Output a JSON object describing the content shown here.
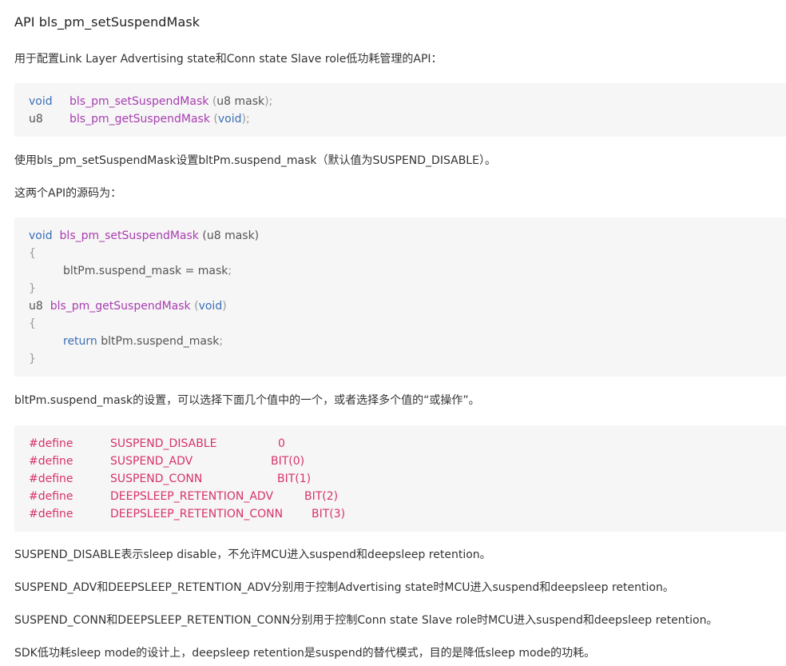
{
  "heading": "API bls_pm_setSuspendMask",
  "intro": "用于配置Link Layer Advertising state和Conn state Slave role低功耗管理的API：",
  "code1": {
    "line1": {
      "type": "void",
      "name": "bls_pm_setSuspendMask",
      "open": "(",
      "arg": "u8 mask",
      "close": ");"
    },
    "line2": {
      "type": "u8",
      "name": "bls_pm_getSuspendMask",
      "open": "(",
      "arg": "void",
      "close": ");"
    }
  },
  "para2": "使用bls_pm_setSuspendMask设置bltPm.suspend_mask（默认值为SUSPEND_DISABLE）。",
  "para3": "这两个API的源码为：",
  "code2": {
    "l1_type": "void",
    "l1_name": "bls_pm_setSuspendMask",
    "l1_args": "(u8 mask)",
    "brace_open": "{",
    "l3_body": "bltPm.suspend_mask = mask",
    "semicolon": ";",
    "brace_close": "}",
    "l5_type": "u8",
    "l5_name": "bls_pm_getSuspendMask",
    "l5_open": "(",
    "l5_arg": "void",
    "l5_close": ")",
    "l7_kw": "return",
    "l7_body": "bltPm.suspend_mask"
  },
  "para4": "bltPm.suspend_mask的设置，可以选择下面几个值中的一个，或者选择多个值的“或操作”。",
  "defines": [
    {
      "kw": "#define",
      "name": "SUSPEND_DISABLE",
      "value": "0"
    },
    {
      "kw": "#define",
      "name": "SUSPEND_ADV",
      "value": "BIT(0)"
    },
    {
      "kw": "#define",
      "name": "SUSPEND_CONN",
      "value": "BIT(1)"
    },
    {
      "kw": "#define",
      "name": "DEEPSLEEP_RETENTION_ADV",
      "value": "BIT(2)"
    },
    {
      "kw": "#define",
      "name": "DEEPSLEEP_RETENTION_CONN",
      "value": "BIT(3)"
    }
  ],
  "para5": "SUSPEND_DISABLE表示sleep disable，不允许MCU进入suspend和deepsleep retention。",
  "para6": "SUSPEND_ADV和DEEPSLEEP_RETENTION_ADV分别用于控制Advertising state时MCU进入suspend和deepsleep retention。",
  "para7": "SUSPEND_CONN和DEEPSLEEP_RETENTION_CONN分别用于控制Conn state Slave role时MCU进入suspend和deepsleep retention。",
  "para8": "SDK低功耗sleep mode的设计上，deepsleep retention是suspend的替代模式，目的是降低sleep mode的功耗。",
  "colors": {
    "keyword": "#3b6fb6",
    "function": "#a83db0",
    "define": "#d6336c",
    "code_bg": "#f6f6f6"
  }
}
